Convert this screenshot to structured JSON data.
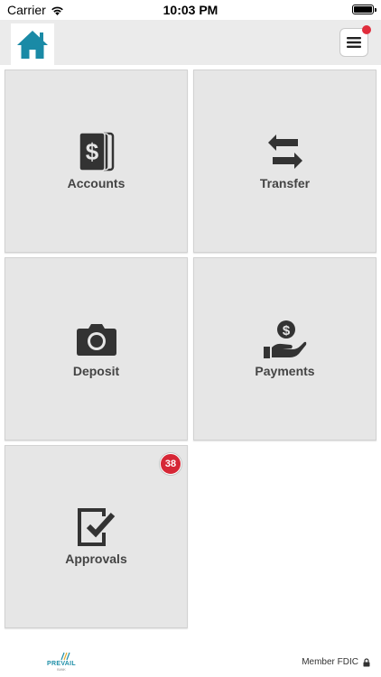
{
  "status_bar": {
    "carrier": "Carrier",
    "time": "10:03 PM"
  },
  "nav": {
    "home_icon": "home-icon",
    "menu_icon": "hamburger-menu-icon",
    "menu_notification": true
  },
  "tiles": [
    {
      "label": "Accounts",
      "icon": "dollar-bills-icon"
    },
    {
      "label": "Transfer",
      "icon": "transfer-arrows-icon"
    },
    {
      "label": "Deposit",
      "icon": "camera-icon"
    },
    {
      "label": "Payments",
      "icon": "hand-dollar-coin-icon"
    },
    {
      "label": "Approvals",
      "icon": "checklist-icon",
      "badge": "38"
    }
  ],
  "footer": {
    "logo_name": "PREVAIL",
    "logo_sub": "BANK",
    "fdic_text": "Member FDIC"
  },
  "colors": {
    "nav_background": "#ebebeb",
    "tile_background": "#e6e6e6",
    "tile_icon": "#333333",
    "home_icon": "#1a8aa6",
    "badge": "#d62736",
    "brand": "#1f8fa8"
  }
}
